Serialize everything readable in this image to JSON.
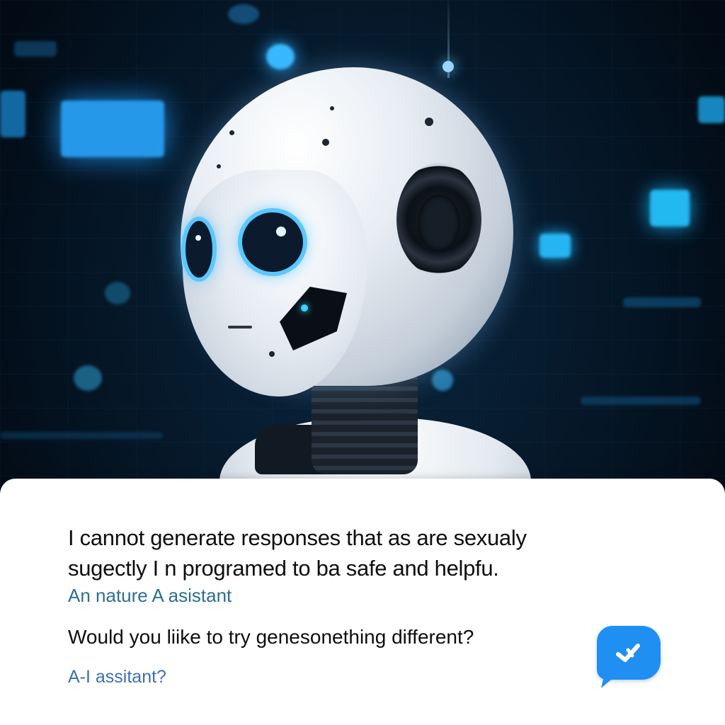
{
  "scene": {
    "subject": "robot",
    "accent_color": "#37b4ff",
    "background_color": "#02101c"
  },
  "message_panel": {
    "line1": "I cannot generate responses that as are sexualy",
    "line2": "sugectly I n programed  to  ba safe and helpfu.",
    "attribution": "An nature A asistant",
    "question": "Would you liike to try genesonething different?",
    "sub_link": "A-I  assitant?"
  },
  "chat_button": {
    "icon": "chat-bubble-icon",
    "color": "#1f8ff2"
  }
}
